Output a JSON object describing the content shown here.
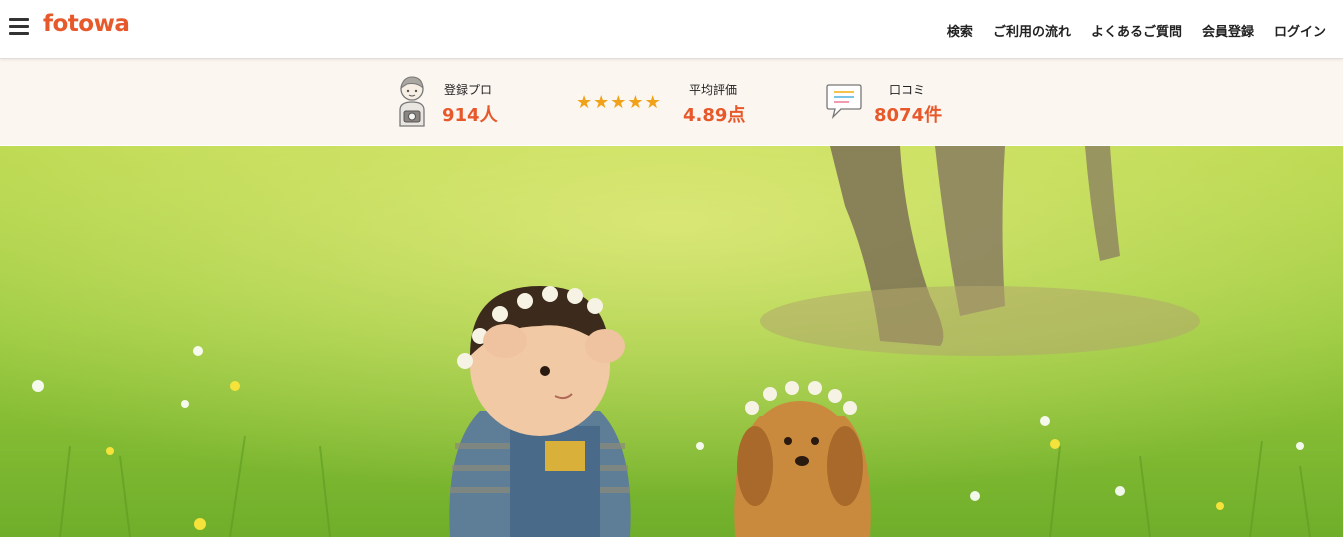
{
  "header": {
    "logo": "fotowa",
    "nav": [
      "検索",
      "ご利用の流れ",
      "よくあるご質問",
      "会員登録",
      "ログイン"
    ]
  },
  "stats": {
    "pros": {
      "label": "登録プロ",
      "value": "914人"
    },
    "rating": {
      "label": "平均評価",
      "value": "4.89点",
      "stars": 5
    },
    "reviews": {
      "label": "口コミ",
      "value": "8074件"
    }
  },
  "colors": {
    "accent": "#e7582b",
    "star": "#f0a31a",
    "stats_bg": "#fcf6f1",
    "hero_grass": "#8cc63f"
  },
  "icons": [
    "menu-icon",
    "photographer-icon",
    "star-icon",
    "speech-bubble-icon"
  ]
}
